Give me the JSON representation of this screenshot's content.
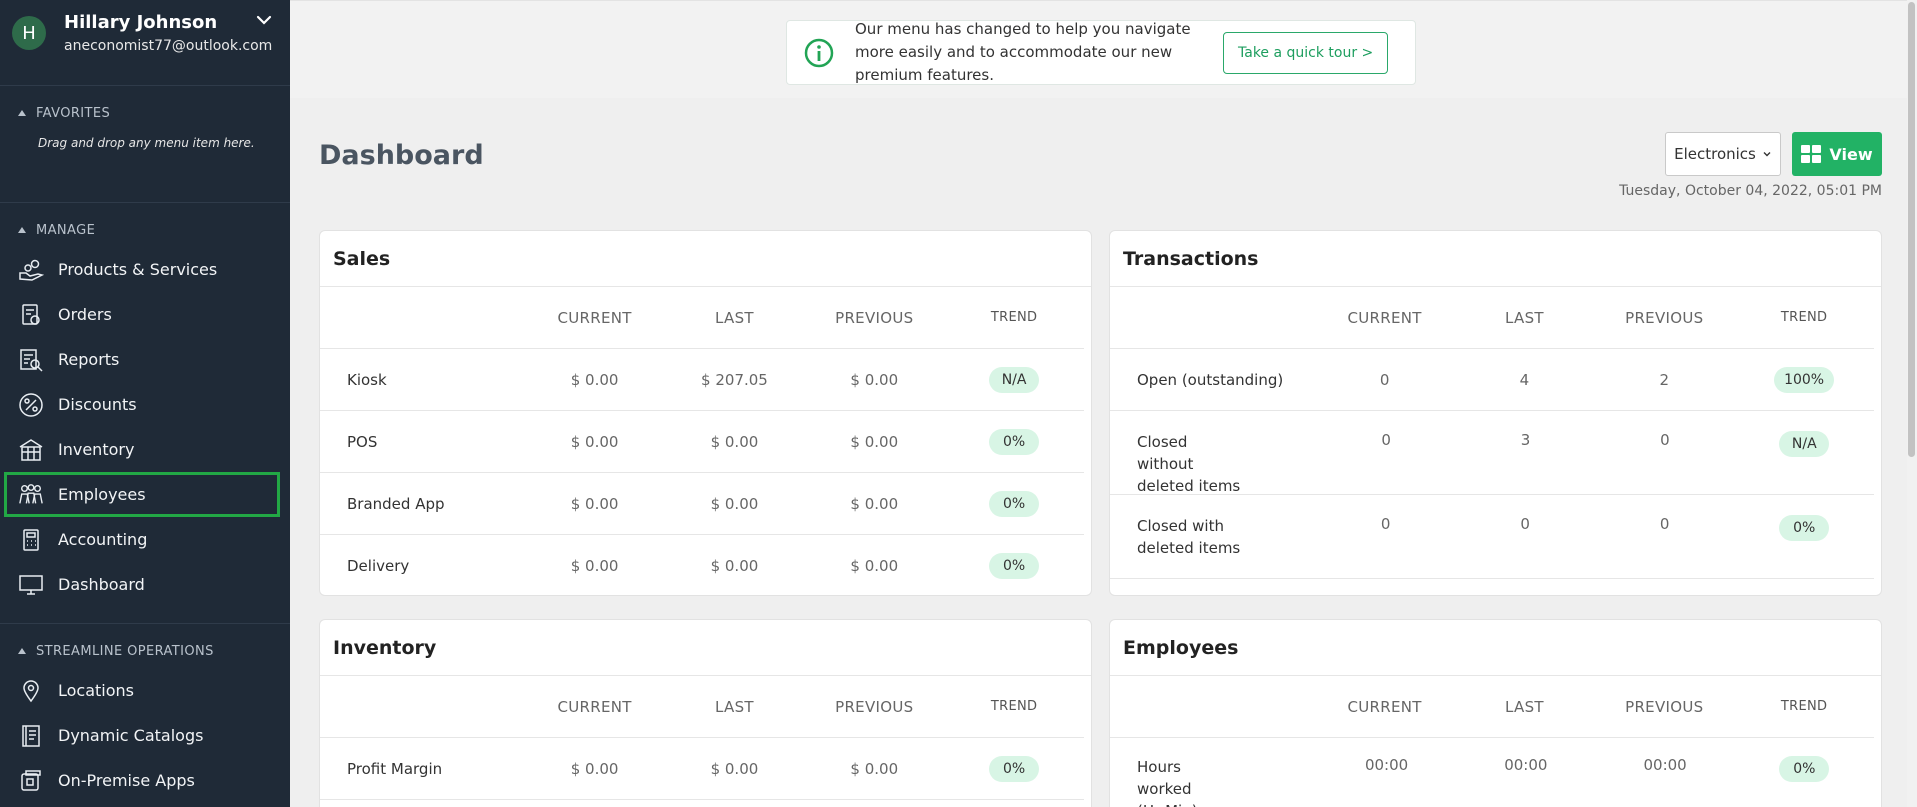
{
  "user": {
    "initial": "H",
    "name": "Hillary Johnson",
    "email": "aneconomist77@outlook.com"
  },
  "favorites": {
    "header": "FAVORITES",
    "note": "Drag and drop any menu item here."
  },
  "manage": {
    "header": "MANAGE",
    "items": [
      {
        "label": "Products & Services",
        "icon": "products-icon"
      },
      {
        "label": "Orders",
        "icon": "orders-icon"
      },
      {
        "label": "Reports",
        "icon": "reports-icon"
      },
      {
        "label": "Discounts",
        "icon": "discounts-icon"
      },
      {
        "label": "Inventory",
        "icon": "inventory-icon"
      },
      {
        "label": "Employees",
        "icon": "employees-icon"
      },
      {
        "label": "Accounting",
        "icon": "accounting-icon"
      },
      {
        "label": "Dashboard",
        "icon": "dashboard-icon"
      }
    ]
  },
  "streamline": {
    "header": "STREAMLINE OPERATIONS",
    "items": [
      {
        "label": "Locations",
        "icon": "location-icon"
      },
      {
        "label": "Dynamic Catalogs",
        "icon": "catalog-icon"
      },
      {
        "label": "On-Premise Apps",
        "icon": "apps-icon"
      }
    ]
  },
  "notice": {
    "text": "Our menu has changed to help you navigate more easily and to accommodate our new premium features.",
    "button": "Take a quick tour >"
  },
  "page": {
    "title": "Dashboard",
    "dropdown": "Electronics",
    "view_button": "View",
    "datetime": "Tuesday, October 04, 2022, 05:01 PM"
  },
  "columns": [
    "CURRENT",
    "LAST",
    "PREVIOUS",
    "TREND"
  ],
  "cards": {
    "sales": {
      "title": "Sales",
      "rows": [
        {
          "label": "Kiosk",
          "current": "$ 0.00",
          "last": "$ 207.05",
          "previous": "$ 0.00",
          "trend": "N/A"
        },
        {
          "label": "POS",
          "current": "$ 0.00",
          "last": "$ 0.00",
          "previous": "$ 0.00",
          "trend": "0%"
        },
        {
          "label": "Branded App",
          "current": "$ 0.00",
          "last": "$ 0.00",
          "previous": "$ 0.00",
          "trend": "0%"
        },
        {
          "label": "Delivery",
          "current": "$ 0.00",
          "last": "$ 0.00",
          "previous": "$ 0.00",
          "trend": "0%"
        }
      ]
    },
    "transactions": {
      "title": "Transactions",
      "rows": [
        {
          "label": "Open (outstanding)",
          "current": "0",
          "last": "4",
          "previous": "2",
          "trend": "100%"
        },
        {
          "label": "Closed without deleted items",
          "current": "0",
          "last": "3",
          "previous": "0",
          "trend": "N/A"
        },
        {
          "label": "Closed with deleted items",
          "current": "0",
          "last": "0",
          "previous": "0",
          "trend": "0%"
        }
      ]
    },
    "inventory": {
      "title": "Inventory",
      "rows": [
        {
          "label": "Profit Margin",
          "current": "$ 0.00",
          "last": "$ 0.00",
          "previous": "$ 0.00",
          "trend": "0%"
        }
      ]
    },
    "employees": {
      "title": "Employees",
      "rows": [
        {
          "label": "Hours worked (Hr:Min)",
          "current": "00:00",
          "last": "00:00",
          "previous": "00:00",
          "trend": "0%"
        }
      ]
    }
  },
  "colors": {
    "sidebar": "#1f2a37",
    "accent": "#22b265",
    "pill": "#d8f5e5",
    "highlight": "#22a845"
  }
}
